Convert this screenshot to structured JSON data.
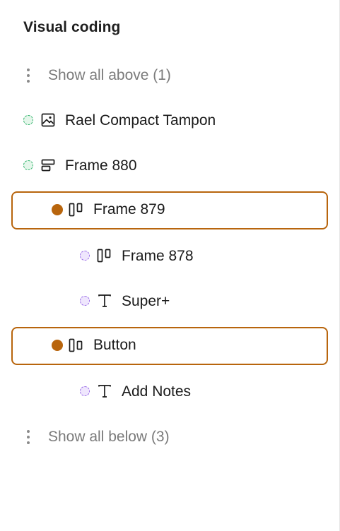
{
  "panel": {
    "title": "Visual coding"
  },
  "items": [
    {
      "kind": "more",
      "label": "Show all above (1)",
      "icon": "more-vertical-icon"
    },
    {
      "kind": "layer",
      "label": "Rael Compact Tampon",
      "icon": "image-icon",
      "status": "green",
      "indent": 0
    },
    {
      "kind": "layer",
      "label": "Frame 880",
      "icon": "horizontal-layout-icon",
      "status": "green",
      "indent": 0
    },
    {
      "kind": "layer",
      "label": "Frame 879",
      "icon": "vertical-layout-icon",
      "status": "orange",
      "indent": 1,
      "selected": true
    },
    {
      "kind": "layer",
      "label": "Frame 878",
      "icon": "vertical-layout-icon",
      "status": "purple",
      "indent": 2
    },
    {
      "kind": "layer",
      "label": "Super+",
      "icon": "text-icon",
      "status": "purple",
      "indent": 2
    },
    {
      "kind": "layer",
      "label": "Button",
      "icon": "vertical-layout-icon",
      "status": "orange",
      "indent": 1,
      "selected": true
    },
    {
      "kind": "layer",
      "label": "Add Notes",
      "icon": "text-icon",
      "status": "purple",
      "indent": 2
    },
    {
      "kind": "more",
      "label": "Show all below (3)",
      "icon": "more-vertical-icon"
    }
  ],
  "colors": {
    "selected_border": "#b8650d",
    "status_orange": "#b8650d",
    "status_green": "#2fb36b",
    "status_purple": "#9a6ce8",
    "muted_text": "#7a7a7a"
  }
}
